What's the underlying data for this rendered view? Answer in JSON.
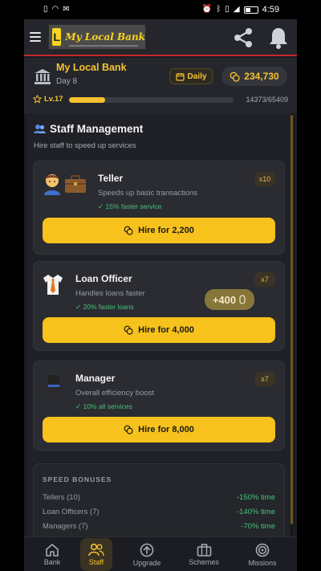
{
  "status_bar": {
    "time": "4:59"
  },
  "header": {
    "logo_text": "My Local Bank",
    "logo_mark": "L",
    "icons": [
      "menu-icon",
      "share-icon",
      "bell-icon"
    ]
  },
  "bank": {
    "name": "My Local Bank",
    "day": "Day 8",
    "frequency_label": "Daily",
    "coins": "234,730",
    "level": "Lv.17",
    "xp_text": "14373/65409",
    "xp_fraction": 0.22
  },
  "staff": {
    "title": "Staff Management",
    "subtitle": "Hire staff to speed up services",
    "cards": [
      {
        "name": "Teller",
        "description": "Speeds up basic transactions",
        "bonus": "✓ 15% faster service",
        "count": "x10",
        "hire_label": "Hire for 2,200"
      },
      {
        "name": "Loan Officer",
        "description": "Handles loans faster",
        "bonus": "✓ 20% faster loans",
        "count": "x7",
        "hire_label": "Hire for 4,000"
      },
      {
        "name": "Manager",
        "description": "Overall efficiency boost",
        "bonus": "✓ 10% all services",
        "count": "x7",
        "hire_label": "Hire for 8,000"
      }
    ],
    "floating_gain": "+400"
  },
  "speed_bonuses": {
    "title": "SPEED BONUSES",
    "rows": [
      {
        "label": "Tellers (10)",
        "value": "-150% time"
      },
      {
        "label": "Loan Officers (7)",
        "value": "-140% time"
      },
      {
        "label": "Managers (7)",
        "value": "-70% time"
      }
    ]
  },
  "nav": {
    "items": [
      {
        "label": "Bank",
        "icon": "home-icon"
      },
      {
        "label": "Staff",
        "icon": "staff-icon"
      },
      {
        "label": "Upgrade",
        "icon": "upgrade-icon"
      },
      {
        "label": "Schemes",
        "icon": "briefcase-icon"
      },
      {
        "label": "Missions",
        "icon": "target-icon"
      }
    ],
    "active": "Staff"
  },
  "colors": {
    "accent": "#f6c22f",
    "button": "#f7c21c",
    "success": "#49c27a",
    "header_rule": "#c62828",
    "background": "#1b1d22"
  }
}
